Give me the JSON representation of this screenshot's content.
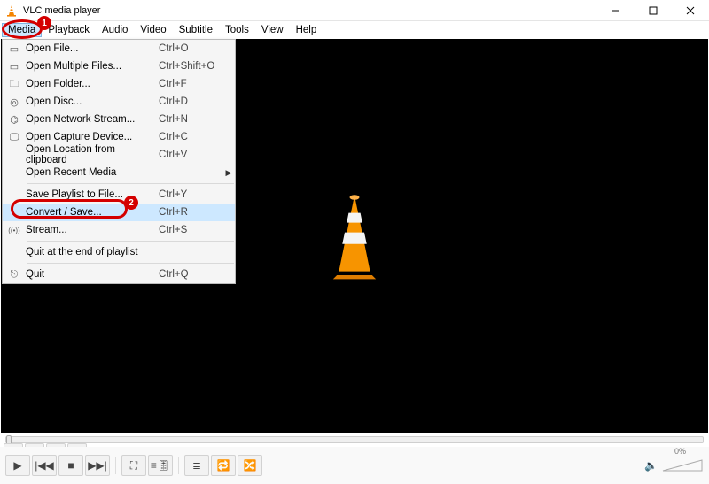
{
  "titlebar": {
    "title": "VLC media player"
  },
  "menubar": {
    "items": [
      "Media",
      "Playback",
      "Audio",
      "Video",
      "Subtitle",
      "Tools",
      "View",
      "Help"
    ]
  },
  "annotations": {
    "one": "1",
    "two": "2"
  },
  "dropdown": {
    "items": [
      {
        "label": "Open File...",
        "shortcut": "Ctrl+O",
        "icon": "file"
      },
      {
        "label": "Open Multiple Files...",
        "shortcut": "Ctrl+Shift+O",
        "icon": "files"
      },
      {
        "label": "Open Folder...",
        "shortcut": "Ctrl+F",
        "icon": "folder"
      },
      {
        "label": "Open Disc...",
        "shortcut": "Ctrl+D",
        "icon": "disc"
      },
      {
        "label": "Open Network Stream...",
        "shortcut": "Ctrl+N",
        "icon": "network"
      },
      {
        "label": "Open Capture Device...",
        "shortcut": "Ctrl+C",
        "icon": "capture"
      },
      {
        "label": "Open Location from clipboard",
        "shortcut": "Ctrl+V",
        "icon": ""
      },
      {
        "label": "Open Recent Media",
        "shortcut": "",
        "icon": "",
        "submenu": true
      }
    ],
    "items2": [
      {
        "label": "Save Playlist to File...",
        "shortcut": "Ctrl+Y",
        "icon": ""
      },
      {
        "label": "Convert / Save...",
        "shortcut": "Ctrl+R",
        "icon": "",
        "highlight": true
      },
      {
        "label": "Stream...",
        "shortcut": "Ctrl+S",
        "icon": "stream"
      }
    ],
    "items3": [
      {
        "label": "Quit at the end of playlist",
        "shortcut": "",
        "icon": ""
      }
    ],
    "items4": [
      {
        "label": "Quit",
        "shortcut": "Ctrl+Q",
        "icon": "quit"
      }
    ]
  },
  "controls": {
    "volume_label": "0%"
  },
  "icons": {
    "file": "▭",
    "files": "▭",
    "folder": "🗀",
    "disc": "◎",
    "network": "⌬",
    "capture": "🖵",
    "stream": "((•))",
    "quit": "⎋"
  }
}
